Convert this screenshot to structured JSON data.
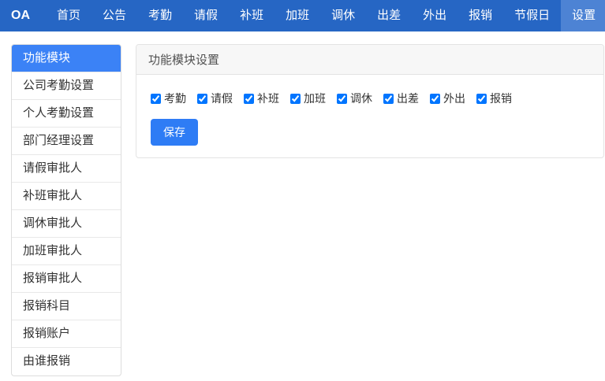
{
  "colors": {
    "navbar-bg": "#2666c4",
    "nav-active-bg": "#4d83d4",
    "sidebar-active-bg": "#3b82f6",
    "accent": "#2e7cf5"
  },
  "navbar": {
    "brand": "OA",
    "items": [
      {
        "name": "home",
        "label": "首页",
        "active": false
      },
      {
        "name": "announcement",
        "label": "公告",
        "active": false
      },
      {
        "name": "attendance",
        "label": "考勤",
        "active": false
      },
      {
        "name": "leave",
        "label": "请假",
        "active": false
      },
      {
        "name": "makeup-shift",
        "label": "补班",
        "active": false
      },
      {
        "name": "overtime",
        "label": "加班",
        "active": false
      },
      {
        "name": "comp-leave",
        "label": "调休",
        "active": false
      },
      {
        "name": "business-trip",
        "label": "出差",
        "active": false
      },
      {
        "name": "out",
        "label": "外出",
        "active": false
      },
      {
        "name": "reimbursement",
        "label": "报销",
        "active": false
      },
      {
        "name": "holiday",
        "label": "节假日",
        "active": false
      },
      {
        "name": "settings",
        "label": "设置",
        "active": true
      }
    ]
  },
  "sidebar": {
    "items": [
      {
        "name": "function-modules",
        "label": "功能模块",
        "active": true
      },
      {
        "name": "company-attendance-settings",
        "label": "公司考勤设置",
        "active": false
      },
      {
        "name": "personal-attendance-settings",
        "label": "个人考勤设置",
        "active": false
      },
      {
        "name": "department-manager-settings",
        "label": "部门经理设置",
        "active": false
      },
      {
        "name": "leave-approver",
        "label": "请假审批人",
        "active": false
      },
      {
        "name": "makeup-shift-approver",
        "label": "补班审批人",
        "active": false
      },
      {
        "name": "comp-leave-approver",
        "label": "调休审批人",
        "active": false
      },
      {
        "name": "overtime-approver",
        "label": "加班审批人",
        "active": false
      },
      {
        "name": "reimbursement-approver",
        "label": "报销审批人",
        "active": false
      },
      {
        "name": "reimbursement-category",
        "label": "报销科目",
        "active": false
      },
      {
        "name": "reimbursement-account",
        "label": "报销账户",
        "active": false
      },
      {
        "name": "reimbursed-by",
        "label": "由谁报销",
        "active": false
      }
    ]
  },
  "main": {
    "panel_title": "功能模块设置",
    "modules": [
      {
        "name": "attendance",
        "label": "考勤",
        "checked": true
      },
      {
        "name": "leave",
        "label": "请假",
        "checked": true
      },
      {
        "name": "makeup-shift",
        "label": "补班",
        "checked": true
      },
      {
        "name": "overtime",
        "label": "加班",
        "checked": true
      },
      {
        "name": "comp-leave",
        "label": "调休",
        "checked": true
      },
      {
        "name": "business-trip",
        "label": "出差",
        "checked": true
      },
      {
        "name": "out",
        "label": "外出",
        "checked": true
      },
      {
        "name": "reimbursement",
        "label": "报销",
        "checked": true
      }
    ],
    "save_label": "保存"
  }
}
